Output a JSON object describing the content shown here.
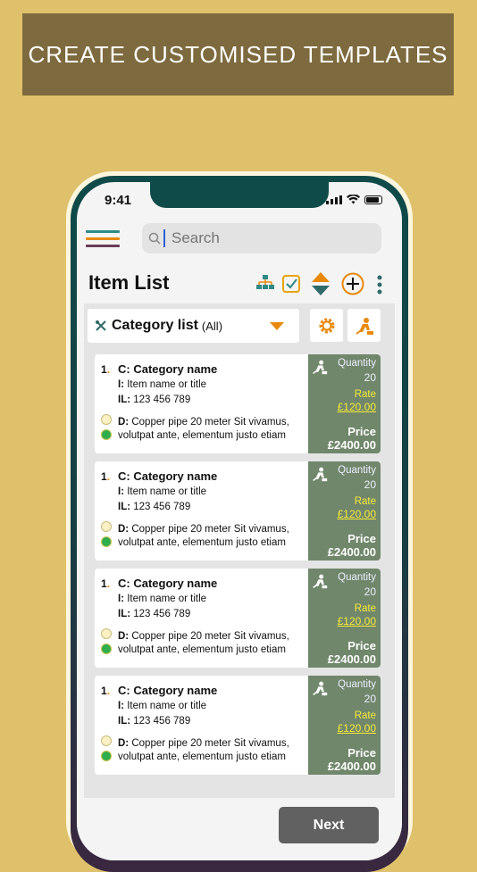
{
  "banner": {
    "text": "CREATE CUSTOMISED TEMPLATES"
  },
  "status": {
    "time": "9:41"
  },
  "search": {
    "placeholder": "Search"
  },
  "page": {
    "title": "Item List"
  },
  "category": {
    "name": "Category list",
    "filter": "(All)"
  },
  "items": [
    {
      "number": "1",
      "category": "C: Category name",
      "item_label": "I:",
      "item_value": "Item name or title",
      "il_label": "IL:",
      "il_value": "123 456 789",
      "desc_label": "D:",
      "desc_value": "Copper pipe 20 meter Sit vivamus, volutpat ante, elementum justo etiam",
      "quantity_label": "Quantity",
      "quantity": "20",
      "rate_label": "Rate",
      "rate": "£120.00",
      "price_label": "Price",
      "price": "£2400.00"
    },
    {
      "number": "1",
      "category": "C: Category name",
      "item_label": "I:",
      "item_value": "Item name or title",
      "il_label": "IL:",
      "il_value": "123 456 789",
      "desc_label": "D:",
      "desc_value": "Copper pipe 20 meter Sit vivamus, volutpat ante, elementum justo etiam",
      "quantity_label": "Quantity",
      "quantity": "20",
      "rate_label": "Rate",
      "rate": "£120.00",
      "price_label": "Price",
      "price": "£2400.00"
    },
    {
      "number": "1",
      "category": "C: Category name",
      "item_label": "I:",
      "item_value": "Item name or title",
      "il_label": "IL:",
      "il_value": "123 456 789",
      "desc_label": "D:",
      "desc_value": "Copper pipe 20 meter Sit vivamus, volutpat ante, elementum justo etiam",
      "quantity_label": "Quantity",
      "quantity": "20",
      "rate_label": "Rate",
      "rate": "£120.00",
      "price_label": "Price",
      "price": "£2400.00"
    },
    {
      "number": "1",
      "category": "C: Category name",
      "item_label": "I:",
      "item_value": "Item name or title",
      "il_label": "IL:",
      "il_value": "123 456 789",
      "desc_label": "D:",
      "desc_value": "Copper pipe 20 meter Sit vivamus, volutpat ante, elementum justo etiam",
      "quantity_label": "Quantity",
      "quantity": "20",
      "rate_label": "Rate",
      "rate": "£120.00",
      "price_label": "Price",
      "price": "£2400.00"
    }
  ],
  "footer": {
    "next_label": "Next"
  },
  "colors": {
    "background": "#dfc16b",
    "banner": "#7d6a3e",
    "accent": "#e8890c",
    "card_panel": "#70876b",
    "rate": "#f6ea3a"
  },
  "icons": [
    "hamburger-menu-icon",
    "search-icon",
    "hierarchy-icon",
    "checkbox-icon",
    "sort-icon",
    "add-circle-icon",
    "more-vertical-icon",
    "tools-icon",
    "dropdown-arrow-icon",
    "gear-icon",
    "worker-icon"
  ]
}
